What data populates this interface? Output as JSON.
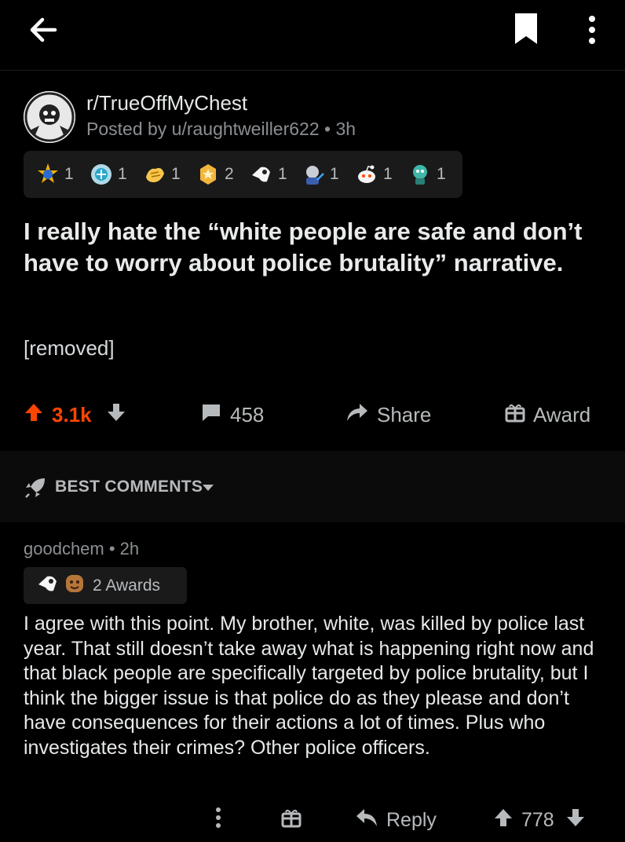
{
  "colors": {
    "background": "#000000",
    "upvote_accent": "#ff4500",
    "muted_text": "#8b8f93",
    "award_bar_bg": "#1a1a1b"
  },
  "topbar": {
    "icons": [
      "back-arrow-icon",
      "bookmark-icon",
      "more-vertical-icon"
    ]
  },
  "post": {
    "subreddit": "r/TrueOffMyChest",
    "posted_by": "Posted by u/raughtweiller622 • 3h",
    "awards": [
      {
        "icon": "award-icon",
        "count": "1"
      },
      {
        "icon": "award-icon",
        "count": "1"
      },
      {
        "icon": "award-icon",
        "count": "1"
      },
      {
        "icon": "award-icon",
        "count": "2"
      },
      {
        "icon": "award-icon",
        "count": "1"
      },
      {
        "icon": "award-icon",
        "count": "1"
      },
      {
        "icon": "award-icon",
        "count": "1"
      },
      {
        "icon": "award-icon",
        "count": "1"
      }
    ],
    "title": "I really hate the “white people are safe and don’t have to worry about police brutality” narrative.",
    "body": "[removed]",
    "score": "3.1k",
    "comments": "458",
    "share_label": "Share",
    "award_label": "Award"
  },
  "sort": {
    "label": "BEST COMMENTS"
  },
  "comment": {
    "author": "goodchem • 2h",
    "awards_label": "2 Awards",
    "body": "I agree with this point. My brother, white, was killed by police last year. That still doesn’t take away what is happening right now and that black people are specifically targeted by police brutality, but I think the bigger issue is that police do as they please and don’t have consequences for their actions a lot of times. Plus who investigates their crimes? Other police officers.",
    "reply_label": "Reply",
    "score": "778"
  }
}
